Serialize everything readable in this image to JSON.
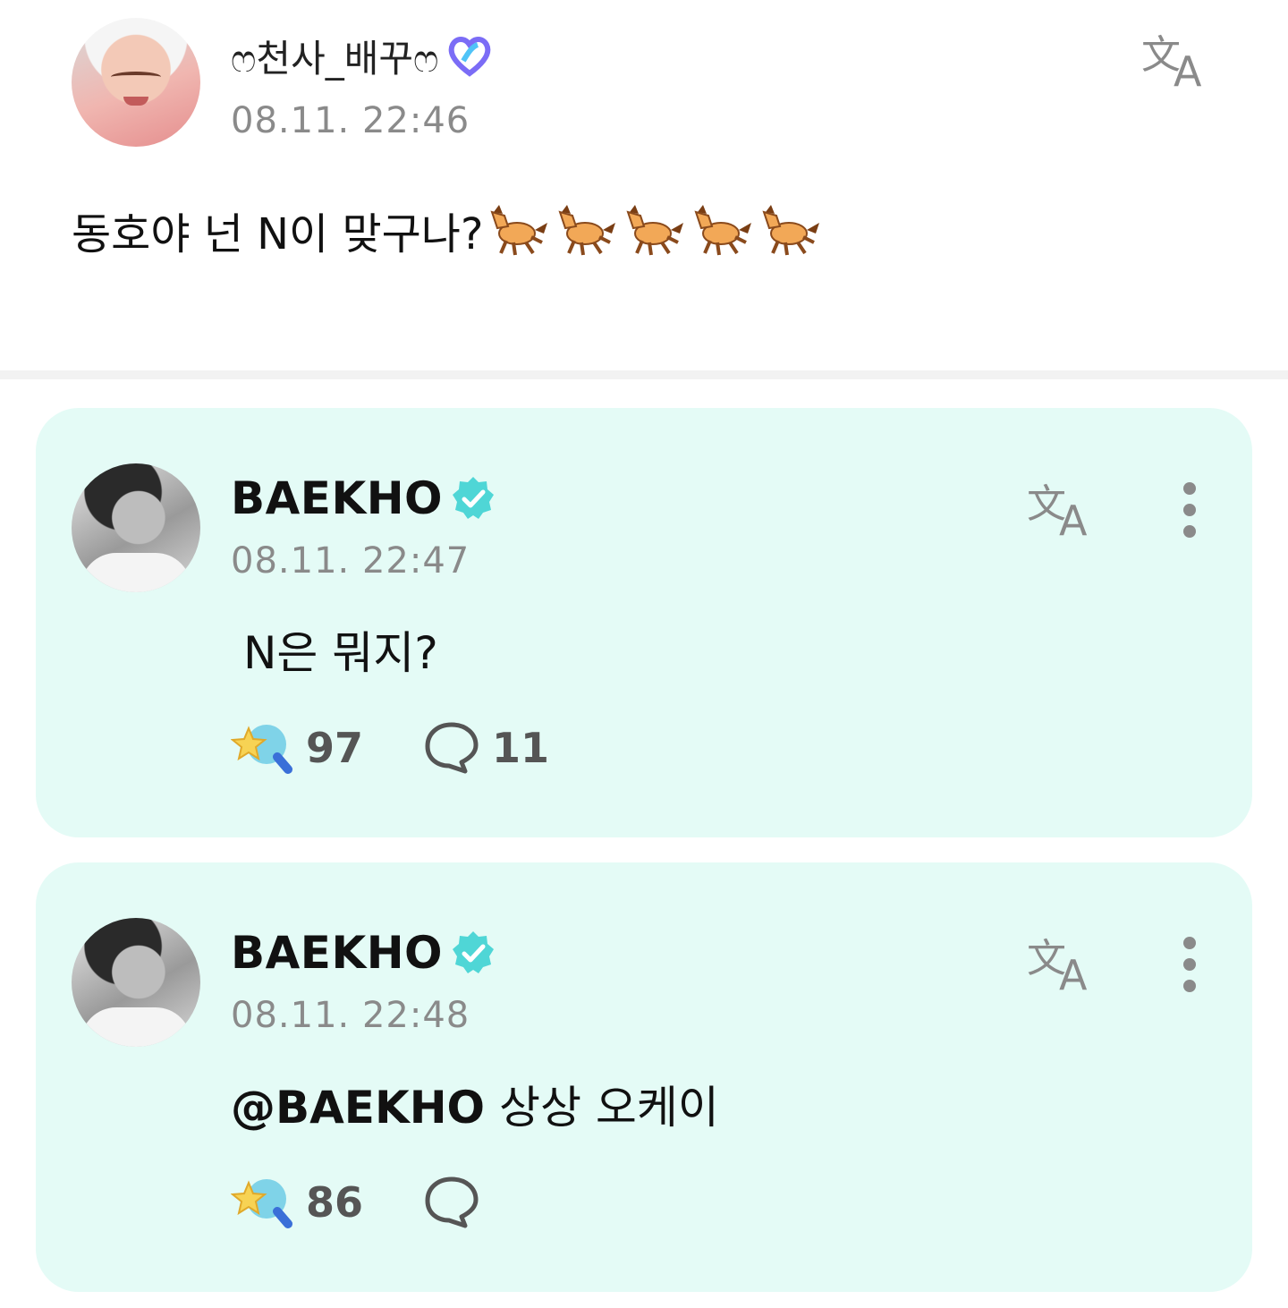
{
  "post": {
    "author": "ෆ천사_배꾸ෆ",
    "time": "08.11. 22:46",
    "text": "동호야 넌 N이 맞구나?",
    "emoji_count": 5,
    "emoji_name": "horse-emoji"
  },
  "comments": [
    {
      "author": "BAEKHO",
      "time": "08.11. 22:47",
      "text": "N은 뭐지?",
      "mention": "",
      "likes": "97",
      "replies": "11"
    },
    {
      "author": "BAEKHO",
      "time": "08.11. 22:48",
      "mention": "@BAEKHO",
      "text": " 상상 오케이",
      "likes": "86",
      "replies": ""
    }
  ],
  "icons": {
    "translate": "translate-icon",
    "more": "more-vertical-icon",
    "verified": "verified-badge-icon",
    "fan_badge": "fan-badge-icon",
    "like": "star-wand-icon",
    "reply": "speech-bubble-icon"
  },
  "colors": {
    "card_bg": "#e4fbf6",
    "verified": "#4fd6d6",
    "fan_badge": "#7b6cf6",
    "time": "#8a8a8a"
  }
}
